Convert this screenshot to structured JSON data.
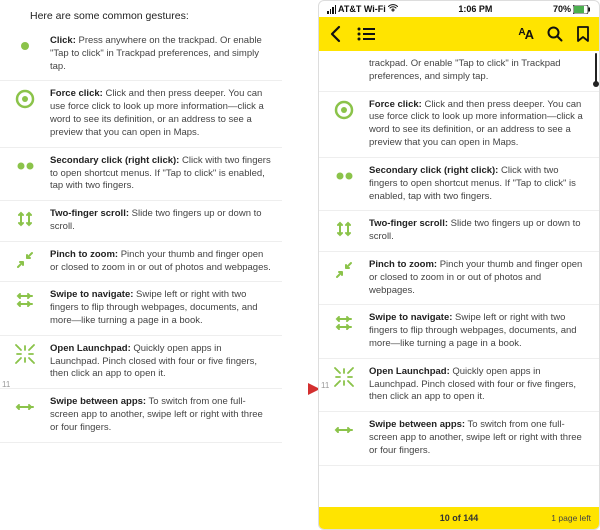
{
  "leftHeader": "Here are some common gestures:",
  "status": {
    "carrier": "AT&T Wi-Fi",
    "time": "1:06 PM",
    "battery": "70%"
  },
  "gestures": {
    "click": {
      "t": "Click:",
      "d": " Press anywhere on the trackpad. Or enable \"Tap to click\" in Trackpad preferences, and simply tap."
    },
    "force": {
      "t": "Force click:",
      "d": " Click and then press deeper. You can use force click to look up more information—click a word to see its definition, or an address to see a preview that you can open in Maps."
    },
    "secondary": {
      "t": "Secondary click (right click):",
      "d": " Click with two fingers to open shortcut menus. If \"Tap to click\" is enabled, tap with two fingers."
    },
    "scroll": {
      "t": "Two-finger scroll:",
      "d": " Slide two fingers up or down to scroll."
    },
    "pinch": {
      "t": "Pinch to zoom:",
      "d": " Pinch your thumb and finger open or closed to zoom in or out of photos and webpages."
    },
    "swipe": {
      "t": "Swipe to navigate:",
      "d": " Swipe left or right with two fingers to flip through webpages, documents, and more—like turning a page in a book."
    },
    "launchpad": {
      "t": "Open Launchpad:",
      "d": " Quickly open apps in Launchpad. Pinch closed with four or five fingers, then click an app to open it."
    },
    "swipeapps": {
      "t": "Swipe between apps:",
      "d": " To switch from one full-screen app to another, swipe left or right with three or four fingers."
    }
  },
  "rightFirstDesc": "trackpad. Or enable \"Tap to click\" in Trackpad preferences, and simply tap.",
  "pageNum": "11",
  "footer": {
    "center": "10 of 144",
    "right": "1 page left"
  }
}
